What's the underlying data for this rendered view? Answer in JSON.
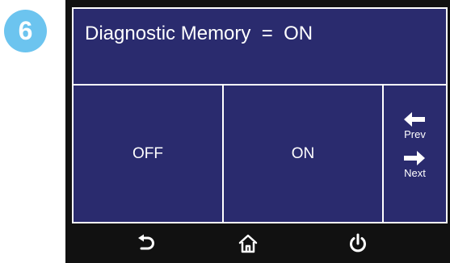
{
  "step": {
    "number": "6",
    "color": "#6cc4ef"
  },
  "screen": {
    "title": "Diagnostic Memory  =  ON",
    "background": "#2a2b6e",
    "options": [
      {
        "label": "OFF"
      },
      {
        "label": "ON"
      }
    ],
    "nav": {
      "prev_label": "Prev",
      "next_label": "Next"
    }
  },
  "hardware_buttons": [
    {
      "name": "back",
      "icon": "back-arrow-icon"
    },
    {
      "name": "home",
      "icon": "home-icon"
    },
    {
      "name": "power",
      "icon": "power-icon"
    }
  ]
}
